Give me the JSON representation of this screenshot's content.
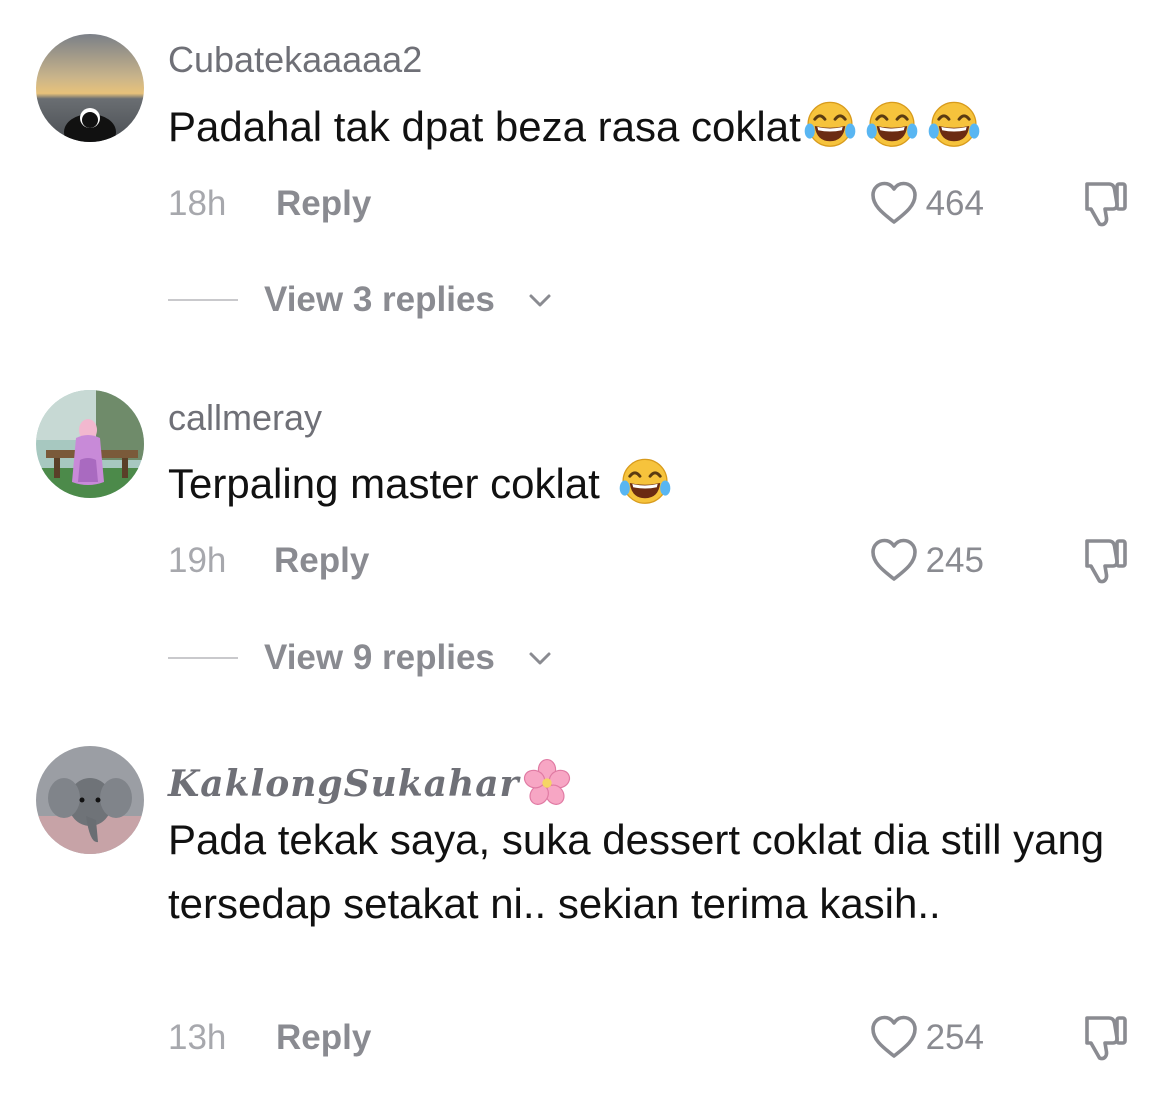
{
  "comments": [
    {
      "username": "Cubatekaaaaa2",
      "text": "Padahal tak dpat beza rasa coklat",
      "emojis": [
        "joy-emoji",
        "joy-emoji",
        "joy-emoji"
      ],
      "time": "18h",
      "reply_label": "Reply",
      "likes": "464",
      "view_replies": "View 3 replies"
    },
    {
      "username": "callmeray",
      "text": "Terpaling master coklat ",
      "emojis": [
        "joy-emoji"
      ],
      "time": "19h",
      "reply_label": "Reply",
      "likes": "245",
      "view_replies": "View 9 replies"
    },
    {
      "username": "KaklongSukahar",
      "username_emoji": "cherry-blossom-emoji",
      "text": "Pada tekak saya, suka dessert coklat dia still yang tersedap setakat ni.. sekian terima kasih..",
      "time": "13h",
      "reply_label": "Reply",
      "likes": "254"
    }
  ],
  "colors": {
    "text_primary": "#111111",
    "text_secondary": "#8a8b91",
    "text_muted": "#a7a8ad",
    "background": "#ffffff"
  }
}
